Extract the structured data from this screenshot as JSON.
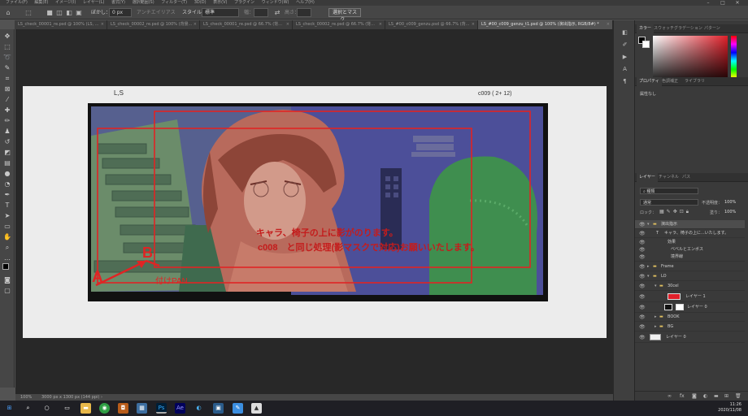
{
  "menubar": {
    "items": [
      "ファイル(F)",
      "編集(E)",
      "イメージ(I)",
      "レイヤー(L)",
      "書式(Y)",
      "選択範囲(S)",
      "フィルター(T)",
      "3D(D)",
      "表示(V)",
      "プラグイン",
      "ウィンドウ(W)",
      "ヘルプ(H)"
    ],
    "minimize": "–",
    "maximize": "□",
    "close": "✕"
  },
  "options": {
    "feather_label": "ぼかし：",
    "feather_value": "0 px",
    "antialias_label": "アンチエイリアス",
    "style_label": "スタイル：",
    "style_value": "標準",
    "width_label": "幅：",
    "height_label": "高さ：",
    "select_mask_button": "選択とマスク..."
  },
  "tabs": [
    {
      "label": "LS_check_00001_re.psd @ 100% (LS, ..."
    },
    {
      "label": "LS_check_00002_re.psd @ 100% (背景..."
    },
    {
      "label": "LS_check_00001_re.psd @ 66.7% (背..."
    },
    {
      "label": "LS_check_00002_re.psd @ 66.7% (背..."
    },
    {
      "label": "LS_#00_c009_genzu.psd @ 66.7% (背..."
    },
    {
      "label": "LS_#00_c009_genzu_t1.psd @ 100% (演出指示, RGB/8#) *"
    }
  ],
  "canvas": {
    "ls_label": "L,S",
    "cut_label": "c009 ( 2+ 12)",
    "note_line1": "キャラ、椅子の上に影がのります。",
    "note_line2": "c008　と同じ処理(影マスクで対応)お願いいたします。",
    "mark_a": "A",
    "mark_b": "B",
    "pan_label": "付けPAN"
  },
  "status": {
    "zoom": "100%",
    "doc_size": "3000 px x 1300 px (144 ppi)"
  },
  "color_panel": {
    "tabs": [
      "カラー",
      "スウォッチ",
      "グラデーション",
      "パターン"
    ],
    "hue_color": "#e0202a"
  },
  "properties_panel": {
    "tabs": [
      "プロパティ",
      "色調補正",
      "ライブラリ"
    ],
    "empty_text": "属性なし"
  },
  "layers_panel": {
    "tabs": [
      "レイヤー",
      "チャンネル",
      "パス"
    ],
    "filter_label": "種類",
    "blend_mode": "通常",
    "opacity_label": "不透明度：",
    "opacity_value": "100%",
    "lock_label": "ロック：",
    "fill_label": "塗り：",
    "fill_value": "100%",
    "layers": [
      {
        "name": "演出指示"
      },
      {
        "name": "キャラ、椅子の上に...いたします。"
      },
      {
        "name": "効果"
      },
      {
        "name": "ベベルとエンボス"
      },
      {
        "name": "境界線"
      },
      {
        "name": "Frame"
      },
      {
        "name": "LO"
      },
      {
        "name": "30cel"
      },
      {
        "name": "レイヤー 1"
      },
      {
        "name": "レイヤー 0"
      },
      {
        "name": "BOOK"
      },
      {
        "name": "BG"
      },
      {
        "name": "レイヤー 0"
      }
    ]
  },
  "taskbar": {
    "time": "11:26",
    "date": "2020/11/08"
  }
}
